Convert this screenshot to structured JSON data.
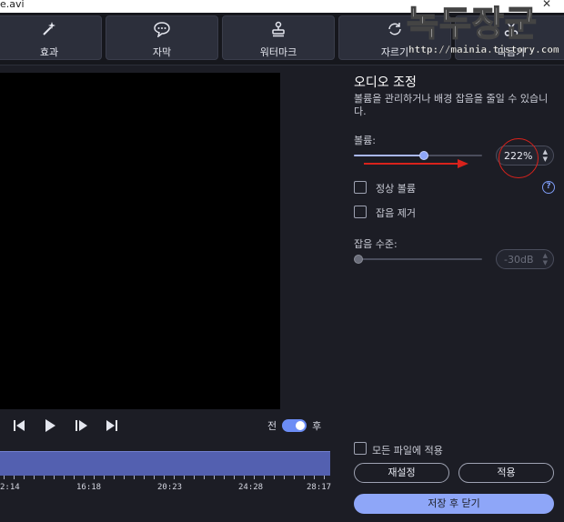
{
  "window": {
    "title": "e.avi",
    "close_glyph": "✕"
  },
  "toolbar": {
    "items": [
      {
        "label": "효과",
        "icon": "magic-wand-icon"
      },
      {
        "label": "자막",
        "icon": "speech-bubble-icon"
      },
      {
        "label": "워터마크",
        "icon": "stamp-icon"
      },
      {
        "label": "자르기",
        "icon": "crop-rotate-icon"
      },
      {
        "label": "다듬기",
        "icon": "scissors-icon"
      }
    ]
  },
  "watermark": {
    "text": "녹두장군",
    "url": "http://mainia.tistory.com"
  },
  "playback": {
    "compare_before": "전",
    "compare_after": "후",
    "compare_on": true
  },
  "timeline": {
    "labels": [
      "2:14",
      "16:18",
      "20:23",
      "24:28",
      "28:17"
    ]
  },
  "audio_panel": {
    "title": "오디오 조정",
    "description": "볼륨을 관리하거나 배경 잡음을 줄일 수 있습니다.",
    "volume_label": "볼륨:",
    "volume_value": "222%",
    "volume_level": 0.55,
    "normalize_label": "정상 볼륨",
    "normalize_checked": false,
    "noise_remove_label": "잡음 제거",
    "noise_remove_checked": false,
    "noise_level_label": "잡음 수준:",
    "noise_level_value": "-30dB",
    "noise_level_position": 0.0,
    "help_glyph": "?",
    "apply_all_label": "모든 파일에 적용",
    "reset_button": "재설정",
    "apply_button": "적용",
    "save_close_button": "저장 후 닫기"
  },
  "colors": {
    "accent": "#8ea6f8",
    "annotation_red": "#d9221c",
    "timeline": "#5360b0"
  }
}
